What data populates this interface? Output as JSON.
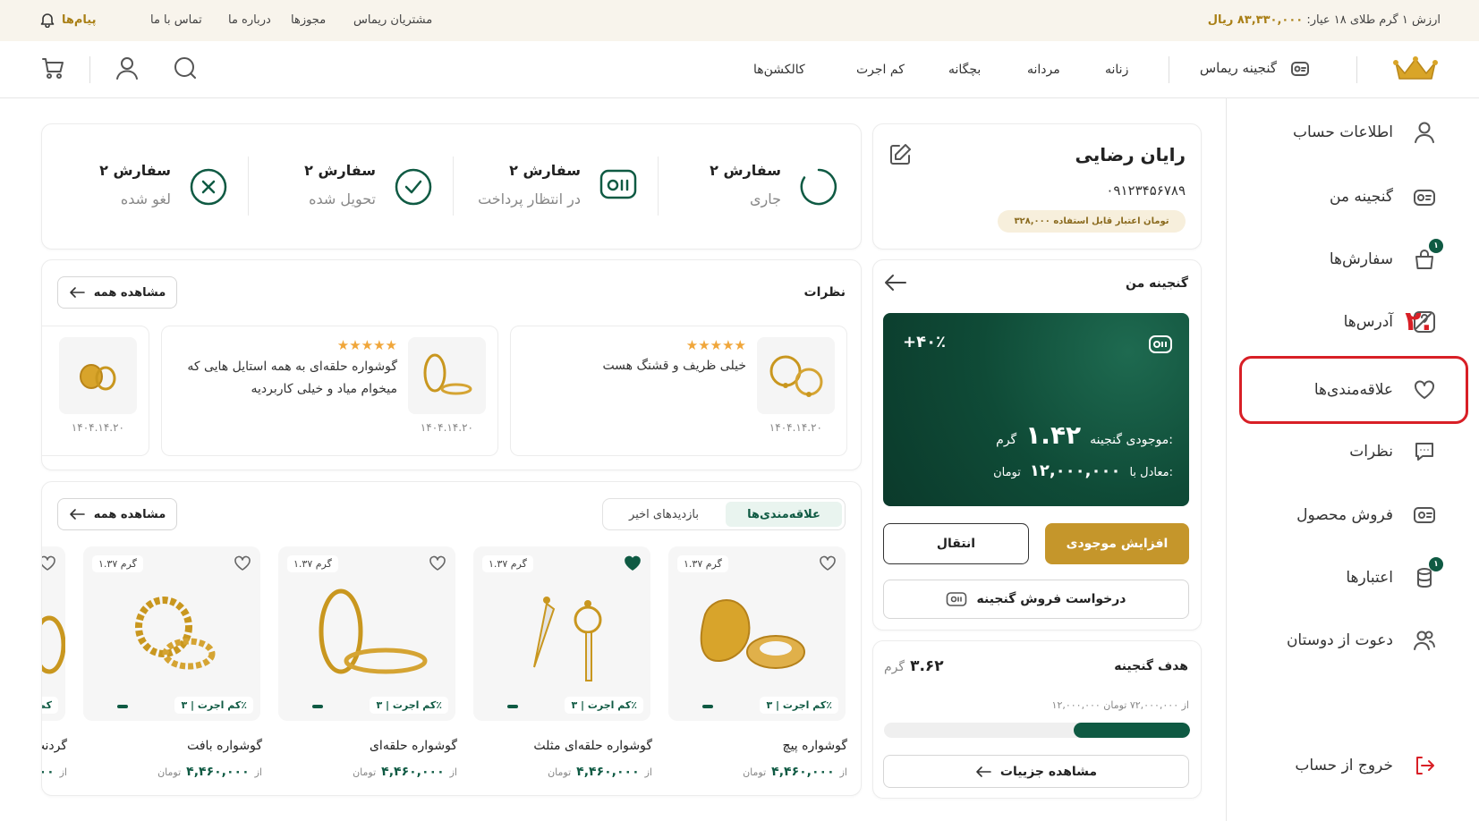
{
  "topbar": {
    "gold_price_label": "ارزش ۱ گرم طلای ۱۸ عیار:",
    "gold_price_value": "۸۳,۳۳۰,۰۰۰ ریال",
    "links": [
      "مشتریان ریماس",
      "مجوزها",
      "درباره ما",
      "تماس با ما"
    ],
    "messages_label": "پیام‌ها"
  },
  "header": {
    "treasure_label": "گنجینه ریماس",
    "nav": [
      "زنانه",
      "مردانه",
      "بچگانه",
      "کم اجرت",
      "کالکشن‌ها"
    ]
  },
  "sidebar": {
    "items": [
      {
        "label": "اطلاعات حساب",
        "icon": "user-icon"
      },
      {
        "label": "گنجینه من",
        "icon": "treasure-icon"
      },
      {
        "label": "سفارش‌ها",
        "icon": "bag-icon",
        "badge": "۱"
      },
      {
        "label": "آدرس‌ها",
        "icon": "map-icon"
      },
      {
        "label": "علاقه‌مندی‌ها",
        "icon": "heart-icon"
      },
      {
        "label": "نظرات",
        "icon": "comment-icon"
      },
      {
        "label": "فروش محصول",
        "icon": "sell-icon"
      },
      {
        "label": "اعتبارها",
        "icon": "credit-icon",
        "badge": "۱"
      },
      {
        "label": "دعوت از دوستان",
        "icon": "friends-icon"
      }
    ],
    "logout_label": "خروج از حساب",
    "step_marker": "۲."
  },
  "profile": {
    "name": "رایان رضایی",
    "phone": "۰۹۱۲۳۴۵۶۷۸۹",
    "credit_badge": "۳۲۸,۰۰۰ تومان اعتبار قابل استفاده"
  },
  "orders": [
    {
      "count": "۲ سفارش",
      "status": "جاری",
      "icon": "spinner-icon"
    },
    {
      "count": "۲ سفارش",
      "status": "در انتظار پرداخت",
      "icon": "payment-icon"
    },
    {
      "count": "۲ سفارش",
      "status": "تحویل شده",
      "icon": "check-icon"
    },
    {
      "count": "۲ سفارش",
      "status": "لغو شده",
      "icon": "cancel-icon"
    }
  ],
  "treasure": {
    "title": "گنجینه من",
    "percent": "+۴۰٪",
    "balance_label": "موجودی گنجینه:",
    "balance_value": "۱.۴۲",
    "balance_unit": "گرم",
    "equiv_label": "معادل با:",
    "equiv_value": "۱۲,۰۰۰,۰۰۰",
    "equiv_unit": "تومان",
    "increase_btn": "افزایش موجودی",
    "transfer_btn": "انتقال",
    "sell_request_btn": "درخواست فروش گنجینه"
  },
  "goal": {
    "title": "هدف گنجینه",
    "value": "۳.۶۲",
    "unit": "گرم",
    "progress_text": "۱۲,۰۰۰,۰۰۰ از ۷۲,۰۰۰,۰۰۰ تومان",
    "progress_fraction": 0.38,
    "details_btn": "مشاهده جزییات"
  },
  "reviews": {
    "title": "نظرات",
    "see_all": "مشاهده همه",
    "items": [
      {
        "text": "خیلی ظریف و قشنگ هست",
        "date": "۱۴۰۴.۱۴.۲۰",
        "stars": 5
      },
      {
        "text": "گوشواره حلقه‌ای به همه استایل هایی که میخوام میاد و خیلی کاربردیه",
        "date": "۱۴۰۴.۱۴.۲۰",
        "stars": 5
      },
      {
        "text": "",
        "date": "۱۴۰۴.۱۴.۲۰",
        "stars": 0
      }
    ]
  },
  "favorites": {
    "tabs": [
      "علاقه‌مندی‌ها",
      "بازدیدهای اخیر"
    ],
    "see_all": "مشاهده همه",
    "products": [
      {
        "name": "گوشواره پیچ",
        "weight": "۱.۳۷ گرم",
        "tag": "کم اجرت | ۳٪",
        "price_from": "از",
        "price": "۴,۴۶۰,۰۰۰",
        "currency": "تومان",
        "liked": false
      },
      {
        "name": "گوشواره حلقه‌ای مثلث",
        "weight": "۱.۳۷ گرم",
        "tag": "کم اجرت | ۳٪",
        "price_from": "از",
        "price": "۴,۴۶۰,۰۰۰",
        "currency": "تومان",
        "liked": true
      },
      {
        "name": "گوشواره حلقه‌ای",
        "weight": "۱.۳۷ گرم",
        "tag": "کم اجرت | ۳٪",
        "price_from": "از",
        "price": "۴,۴۶۰,۰۰۰",
        "currency": "تومان",
        "liked": false
      },
      {
        "name": "گوشواره بافت",
        "weight": "۱.۳۷ گرم",
        "tag": "کم اجرت | ۳٪",
        "price_from": "از",
        "price": "۴,۴۶۰,۰۰۰",
        "currency": "تومان",
        "liked": false
      }
    ],
    "partial_name": "گردنب",
    "partial_price": "۰۰",
    "partial_from": "از",
    "partial_tag": "کم"
  },
  "colors": {
    "brand_green": "#0f5a43",
    "gold": "#c5962b",
    "highlight_red": "#d81f26"
  }
}
